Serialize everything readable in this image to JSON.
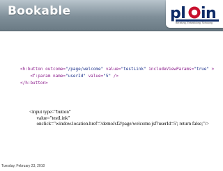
{
  "header": {
    "title": "Bookable",
    "logo": {
      "brand": "plain",
      "tagline": "Beratung, Entwicklung, Schulung"
    }
  },
  "code_block_1": {
    "line1": {
      "tag": "<h:button",
      "a1": " outcome=",
      "v1": "\"/page/welcome\"",
      "a2": " value=",
      "v2": "\"testLink\"",
      "a3": " includeViewParams=",
      "v3": "\"true\"",
      "end": " >"
    },
    "line2": {
      "tag": "    <f:param",
      "a1": " name=",
      "v1": "\"userId\"",
      "a2": " value=",
      "v2": "\"5\"",
      "end": " />"
    },
    "line3": {
      "tag": "</h:button>"
    }
  },
  "code_block_2": {
    "line1": "<input type=\"button\"",
    "line2": "      value=\"testLink\"",
    "line3": "      onclick=\"window.location.href='/demoJsf2/page/welcome.jsf?userId=5'; return false;\"/>"
  },
  "footer": {
    "date": "Tuesday, February 23, 2010"
  }
}
